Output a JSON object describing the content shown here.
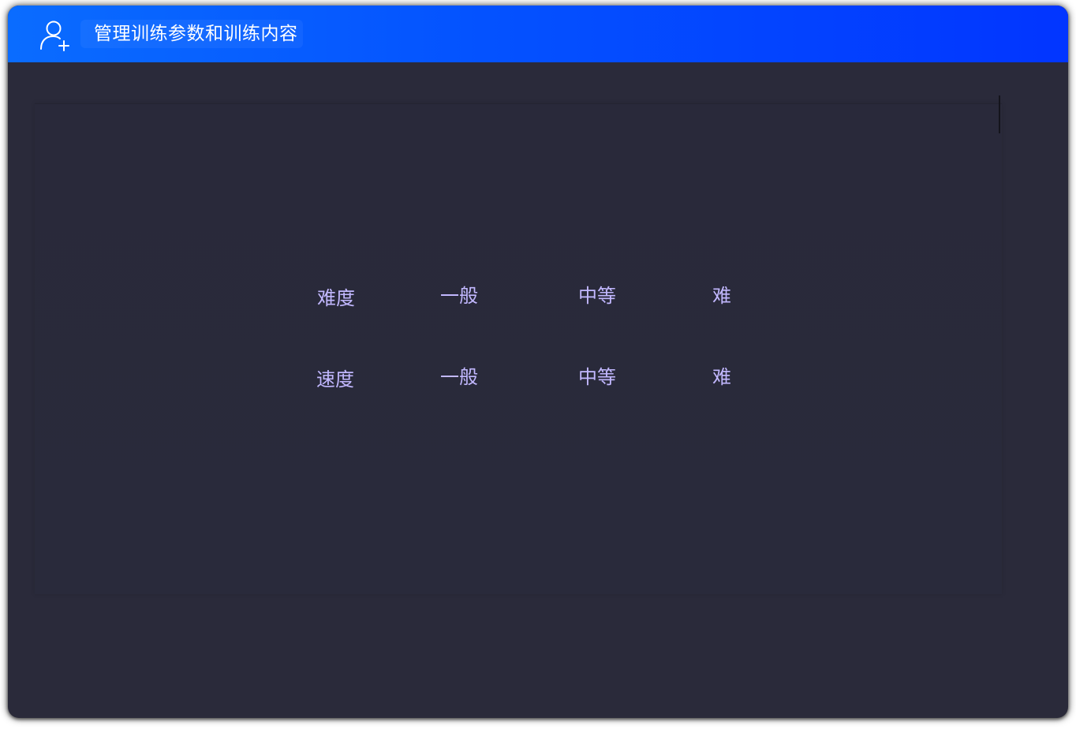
{
  "header": {
    "title": "管理训练参数和训练内容",
    "icon": "user-add-icon"
  },
  "settings": {
    "rows": [
      {
        "label": "难度",
        "options": [
          "一般",
          "中等",
          "难"
        ]
      },
      {
        "label": "速度",
        "options": [
          "一般",
          "中等",
          "难"
        ]
      }
    ]
  },
  "colors": {
    "header_gradient_start": "#0a6cff",
    "header_gradient_end": "#0235ff",
    "background": "#2a2a3a",
    "option_text": "#c2b8ff",
    "title_text": "#ffffff"
  }
}
